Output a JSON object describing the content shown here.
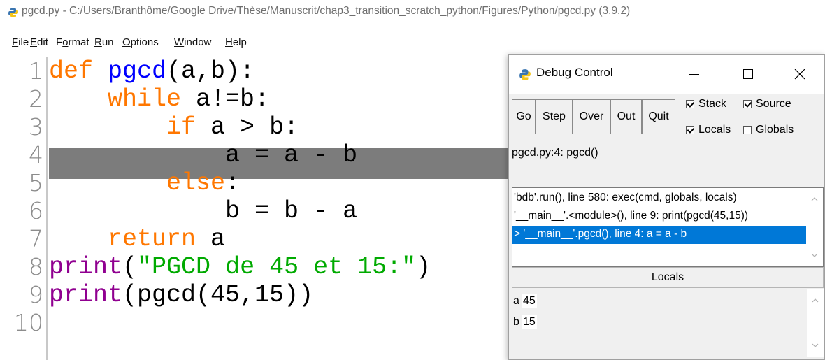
{
  "window": {
    "title": "pgcd.py - C:/Users/Branthôme/Google Drive/Thèse/Manuscrit/chap3_transition_scratch_python/Figures/Python/pgcd.py (3.9.2)",
    "icon": "python-icon"
  },
  "menu": [
    {
      "label": "File"
    },
    {
      "label": "Edit"
    },
    {
      "label": "Format"
    },
    {
      "label": "Run"
    },
    {
      "label": "Options"
    },
    {
      "label": "Window"
    },
    {
      "label": "Help"
    }
  ],
  "editor": {
    "line_numbers": [
      "1",
      "2",
      "3",
      "4",
      "5",
      "6",
      "7",
      "8",
      "9",
      "10"
    ],
    "current_line": 4,
    "lines": [
      [
        {
          "t": "def",
          "c": "kw"
        },
        {
          "t": " "
        },
        {
          "t": "pgcd",
          "c": "fn"
        },
        {
          "t": "(a,b):"
        }
      ],
      [
        {
          "t": "    "
        },
        {
          "t": "while",
          "c": "kw"
        },
        {
          "t": " a!=b:"
        }
      ],
      [
        {
          "t": "        "
        },
        {
          "t": "if",
          "c": "kw"
        },
        {
          "t": " a > b:"
        }
      ],
      [
        {
          "t": "            a = a - b"
        }
      ],
      [
        {
          "t": "        "
        },
        {
          "t": "else",
          "c": "kw"
        },
        {
          "t": ":"
        }
      ],
      [
        {
          "t": "            b = b - a"
        }
      ],
      [
        {
          "t": "    "
        },
        {
          "t": "return",
          "c": "kw"
        },
        {
          "t": " a"
        }
      ],
      [
        {
          "t": "print",
          "c": "bi"
        },
        {
          "t": "("
        },
        {
          "t": "\"PGCD de 45 et 15:\"",
          "c": "st"
        },
        {
          "t": ")"
        }
      ],
      [
        {
          "t": "print",
          "c": "bi"
        },
        {
          "t": "(pgcd(45,15))"
        }
      ],
      [
        {
          "t": ""
        }
      ]
    ]
  },
  "colors": {
    "keyword": "#ff7700",
    "function_name": "#0000ff",
    "builtin": "#900090",
    "string": "#00aa00",
    "current_line_bg": "#7c7c7c",
    "selection": "#0078d7"
  },
  "debug": {
    "title": "Debug Control",
    "buttons": {
      "go": "Go",
      "step": "Step",
      "over": "Over",
      "out": "Out",
      "quit": "Quit"
    },
    "options": {
      "stack": {
        "label": "Stack",
        "checked": true
      },
      "source": {
        "label": "Source",
        "checked": true
      },
      "locals": {
        "label": "Locals",
        "checked": true
      },
      "globals": {
        "label": "Globals",
        "checked": false
      }
    },
    "status": "pgcd.py:4: pgcd()",
    "stack": [
      "'bdb'.run(), line 580: exec(cmd, globals, locals)",
      "'__main__'.<module>(), line 9: print(pgcd(45,15))",
      "> '__main__'.pgcd(), line 4: a = a - b"
    ],
    "stack_selected": 2,
    "locals_header": "Locals",
    "locals": [
      {
        "name": "a",
        "value": "45"
      },
      {
        "name": "b",
        "value": "15"
      }
    ]
  }
}
